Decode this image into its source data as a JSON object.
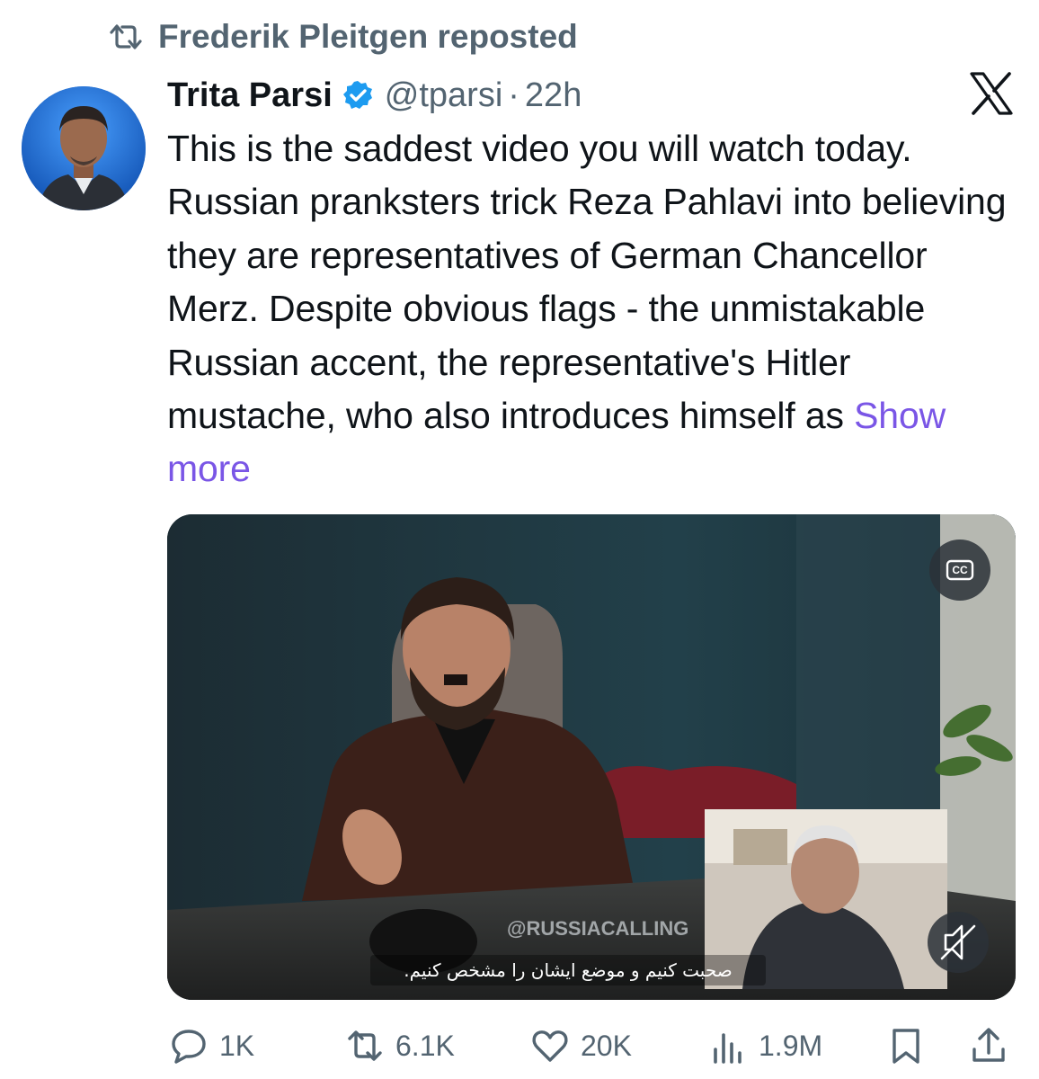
{
  "repost": {
    "text": "Frederik Pleitgen reposted",
    "icon": "repost-icon"
  },
  "tweet": {
    "author": "Trita Parsi",
    "handle": "@tparsi",
    "separator": "·",
    "time": "22h",
    "text": "This is the saddest video you will watch today. Russian pranksters trick Reza Pahlavi into believing they are representatives of German Chancellor Merz. Despite obvious flags - the unmistakable Russian accent, the representative's Hitler mustache, who also introduces himself as ",
    "show_more": "Show more"
  },
  "media": {
    "watermark": "@RUSSIACALLING",
    "subtitle": "صحبت کنیم و موضع ایشان را مشخص کنیم.",
    "cc_label": "CC"
  },
  "actions": {
    "replies": "1K",
    "reposts": "6.1K",
    "likes": "20K",
    "views": "1.9M"
  },
  "colors": {
    "text": "#0f1419",
    "muted": "#536471",
    "link": "#7a56e6",
    "verified": "#1d9bf0"
  }
}
